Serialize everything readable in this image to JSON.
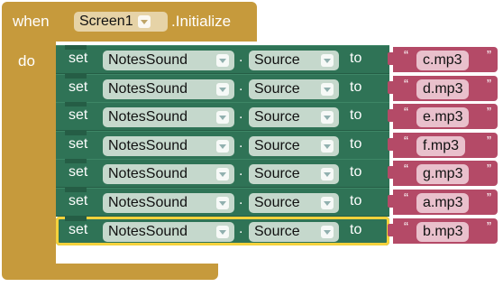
{
  "event": {
    "when_label": "when",
    "component": "Screen1",
    "event_name": ".Initialize",
    "do_label": "do"
  },
  "rows": [
    {
      "set": "set",
      "component": "NotesSound",
      "dot": ".",
      "property": "Source",
      "to": "to",
      "value": "c.mp3"
    },
    {
      "set": "set",
      "component": "NotesSound",
      "dot": ".",
      "property": "Source",
      "to": "to",
      "value": "d.mp3"
    },
    {
      "set": "set",
      "component": "NotesSound",
      "dot": ".",
      "property": "Source",
      "to": "to",
      "value": "e.mp3"
    },
    {
      "set": "set",
      "component": "NotesSound",
      "dot": ".",
      "property": "Source",
      "to": "to",
      "value": "f.mp3"
    },
    {
      "set": "set",
      "component": "NotesSound",
      "dot": ".",
      "property": "Source",
      "to": "to",
      "value": "g.mp3"
    },
    {
      "set": "set",
      "component": "NotesSound",
      "dot": ".",
      "property": "Source",
      "to": "to",
      "value": "a.mp3"
    },
    {
      "set": "set",
      "component": "NotesSound",
      "dot": ".",
      "property": "Source",
      "to": "to",
      "value": "b.mp3"
    }
  ],
  "quote_open": "“",
  "quote_close": "”",
  "colors": {
    "event_block": "#c69a3c",
    "setter_block": "#2f7356",
    "text_block": "#b44a67",
    "selection": "#f5d23c"
  }
}
